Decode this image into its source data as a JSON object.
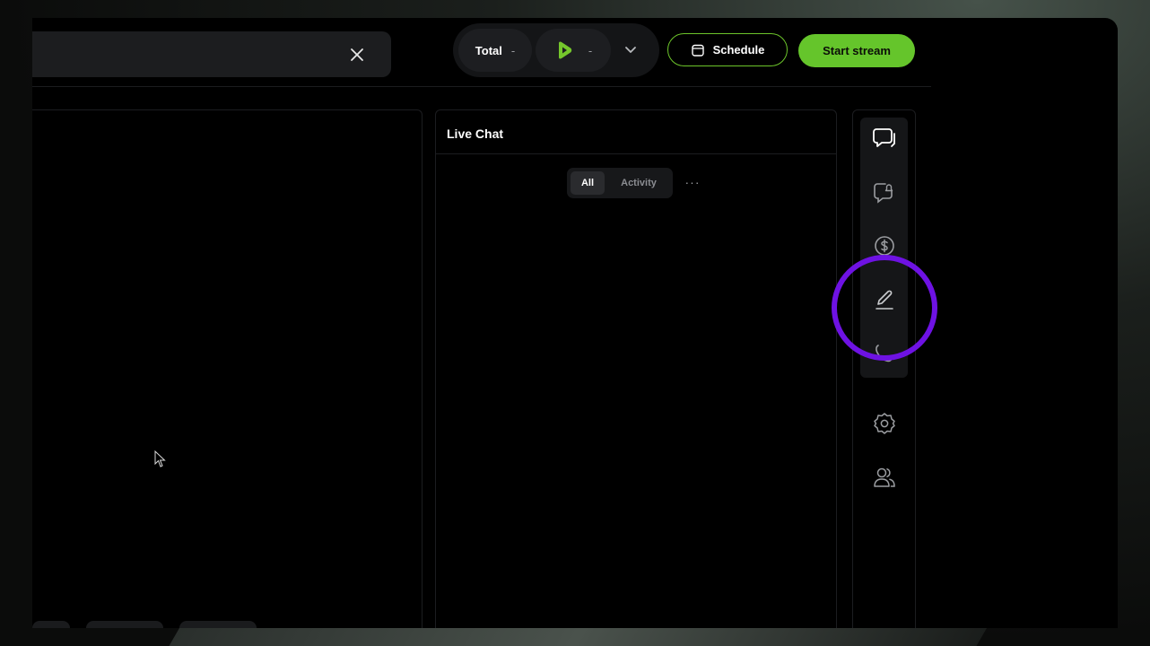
{
  "header": {
    "stats": {
      "total_label": "Total",
      "total_value": "-",
      "rumble_value": "-"
    },
    "schedule_label": "Schedule",
    "start_stream_label": "Start stream"
  },
  "chat": {
    "title": "Live Chat",
    "tabs": [
      "All",
      "Activity"
    ],
    "active_tab": "All",
    "more": "···"
  },
  "sidebar_rail": {
    "items": [
      "chat-icon",
      "alert-bubble-icon",
      "dollar-icon",
      "pencil-icon",
      "phone-icon"
    ],
    "bottom_items": [
      "gear-icon",
      "users-icon"
    ]
  },
  "colors": {
    "accent_green": "#65c52b",
    "highlight_purple": "#6e12e3",
    "panel_bg": "#000000"
  }
}
